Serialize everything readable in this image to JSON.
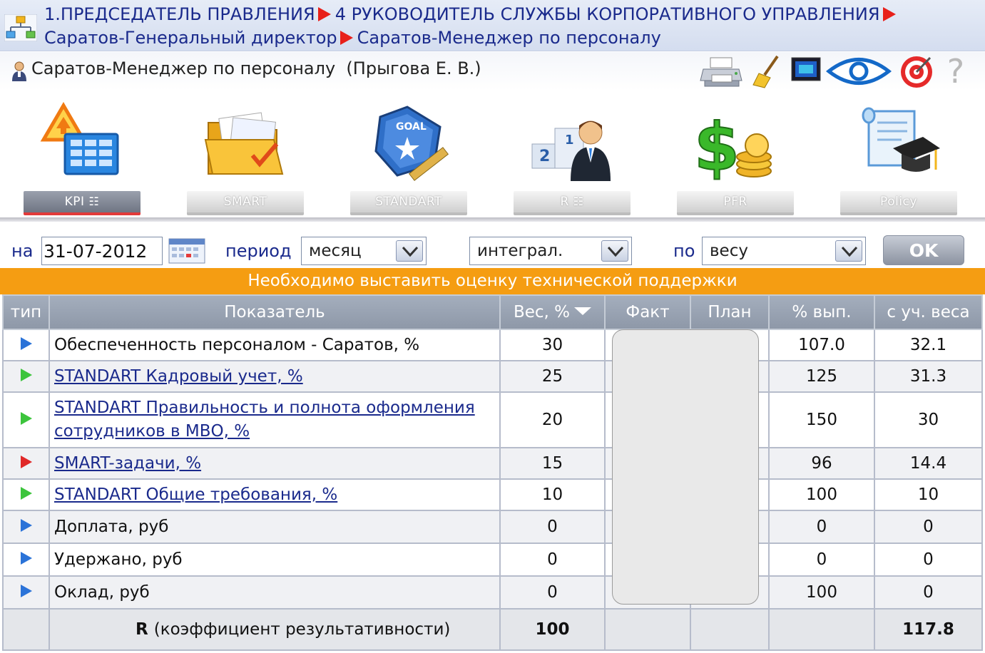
{
  "breadcrumb": {
    "items": [
      "1.ПРЕДСЕДАТЕЛЬ ПРАВЛЕНИЯ",
      "4 РУКОВОДИТЕЛЬ СЛУЖБЫ КОРПОРАТИВНОГО УПРАВЛЕНИЯ",
      "Саратов-Генеральный директор",
      "Саратов-Менеджер по персоналу"
    ]
  },
  "user": {
    "name": "Саратов-Менеджер по персоналу  (Прыгова Е. В.)"
  },
  "toolbar": {
    "icons": [
      "printer-icon",
      "broom-icon",
      "monitor-icon",
      "eye-icon",
      "target-icon",
      "help-icon"
    ],
    "help_label": "?"
  },
  "modules": [
    {
      "label": "KPI",
      "active": true
    },
    {
      "label": "SMART",
      "active": false
    },
    {
      "label": "STANDART",
      "active": false
    },
    {
      "label": "R",
      "active": false
    },
    {
      "label": "PFR",
      "active": false
    },
    {
      "label": "Policy",
      "active": false
    }
  ],
  "filters": {
    "date_label": "на",
    "date_value": "31-07-2012",
    "period_label": "период",
    "period_value": "месяц",
    "mode_value": "интеграл.",
    "by_label": "по",
    "by_value": "весу",
    "ok_label": "OK"
  },
  "notice": "Необходимо выставить оценку технической поддержки",
  "table": {
    "headers": [
      "тип",
      "Показатель",
      "Вес, %",
      "Факт",
      "План",
      "% вып.",
      "с уч. веса"
    ],
    "rows": [
      {
        "type": "blue",
        "name": "Обеспеченность персоналом - Саратов, %",
        "link": false,
        "weight": "30",
        "fact": "",
        "plan": "",
        "pct": "107.0",
        "weighted": "32.1"
      },
      {
        "type": "green",
        "name": "STANDART Кадровый учет, %",
        "link": true,
        "weight": "25",
        "fact": "",
        "plan": "",
        "pct": "125",
        "weighted": "31.3"
      },
      {
        "type": "green",
        "name": "STANDART Правильность и полнота оформления сотрудников в МВО, %",
        "link": true,
        "weight": "20",
        "fact": "",
        "plan": "",
        "pct": "150",
        "weighted": "30"
      },
      {
        "type": "red",
        "name": "SMART-задачи, %",
        "link": true,
        "weight": "15",
        "fact": "",
        "plan": "",
        "pct": "96",
        "weighted": "14.4"
      },
      {
        "type": "green",
        "name": "STANDART Общие требования, %",
        "link": true,
        "weight": "10",
        "fact": "",
        "plan": "",
        "pct": "100",
        "weighted": "10"
      },
      {
        "type": "blue",
        "name": "Доплата, руб",
        "link": false,
        "weight": "0",
        "fact": "",
        "plan": "",
        "pct": "0",
        "weighted": "0"
      },
      {
        "type": "blue",
        "name": "Удержано, руб",
        "link": false,
        "weight": "0",
        "fact": "",
        "plan": "",
        "pct": "0",
        "weighted": "0"
      },
      {
        "type": "blue",
        "name": "Оклад, руб",
        "link": false,
        "weight": "0",
        "fact": "",
        "plan": "",
        "pct": "100",
        "weighted": "0"
      }
    ],
    "total": {
      "label": "R",
      "sublabel": "(коэффициент результативности)",
      "weight": "100",
      "weighted": "117.8"
    }
  },
  "colors": {
    "breadcrumb_text": "#1a2a8c",
    "arrow": "#e8201a",
    "notice_bg": "#f59d12",
    "header_bg": "#98a2b2",
    "type_blue": "#2b73d8",
    "type_green": "#3cc43c",
    "type_red": "#e02828"
  }
}
